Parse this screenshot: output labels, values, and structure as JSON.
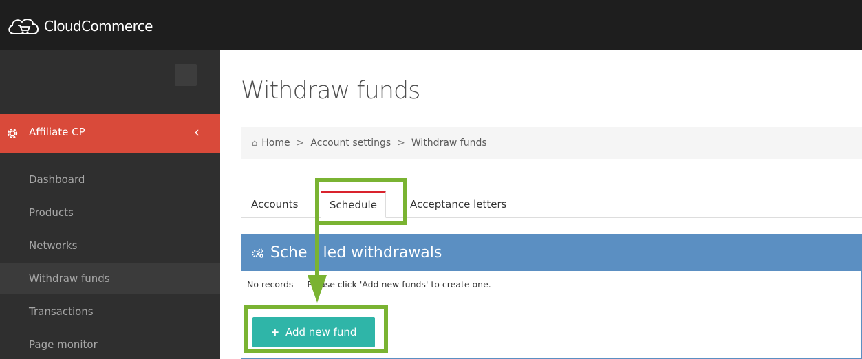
{
  "app": {
    "logo_text": "CloudCommerce"
  },
  "sidebar": {
    "section_label": "Affiliate CP",
    "section_chevron": "‹",
    "items": [
      {
        "label": "Dashboard"
      },
      {
        "label": "Products"
      },
      {
        "label": "Networks"
      },
      {
        "label": "Withdraw funds"
      },
      {
        "label": "Transactions"
      },
      {
        "label": "Page monitor"
      }
    ]
  },
  "main": {
    "title": "Withdraw funds",
    "breadcrumb": {
      "home_icon": "⌂",
      "items": [
        "Home",
        "Account settings",
        "Withdraw funds"
      ],
      "separator": ">"
    },
    "tabs": [
      {
        "label": "Accounts"
      },
      {
        "label": "Schedule"
      },
      {
        "label": "Acceptance letters"
      }
    ],
    "panel": {
      "title_part1": "Sche",
      "title_part2": "led withdrawals",
      "message_part1": "No records",
      "message_part2": "Please click 'Add new funds' to create one.",
      "button_label": "Add new fund",
      "button_plus": "+"
    }
  },
  "colors": {
    "topbar": "#1e1e1e",
    "sidebar": "#2f2f2f",
    "section_accent": "#d94a3a",
    "panel_header": "#5b8fc2",
    "add_button": "#2fb5a8",
    "annotation": "#7ab332",
    "tab_active_border": "#d9232d"
  },
  "icons": {
    "logo": "cloud-cart-icon",
    "menu": "hamburger-icon",
    "section": "gear-icon",
    "home": "home-icon",
    "panel": "cogs-icon"
  }
}
